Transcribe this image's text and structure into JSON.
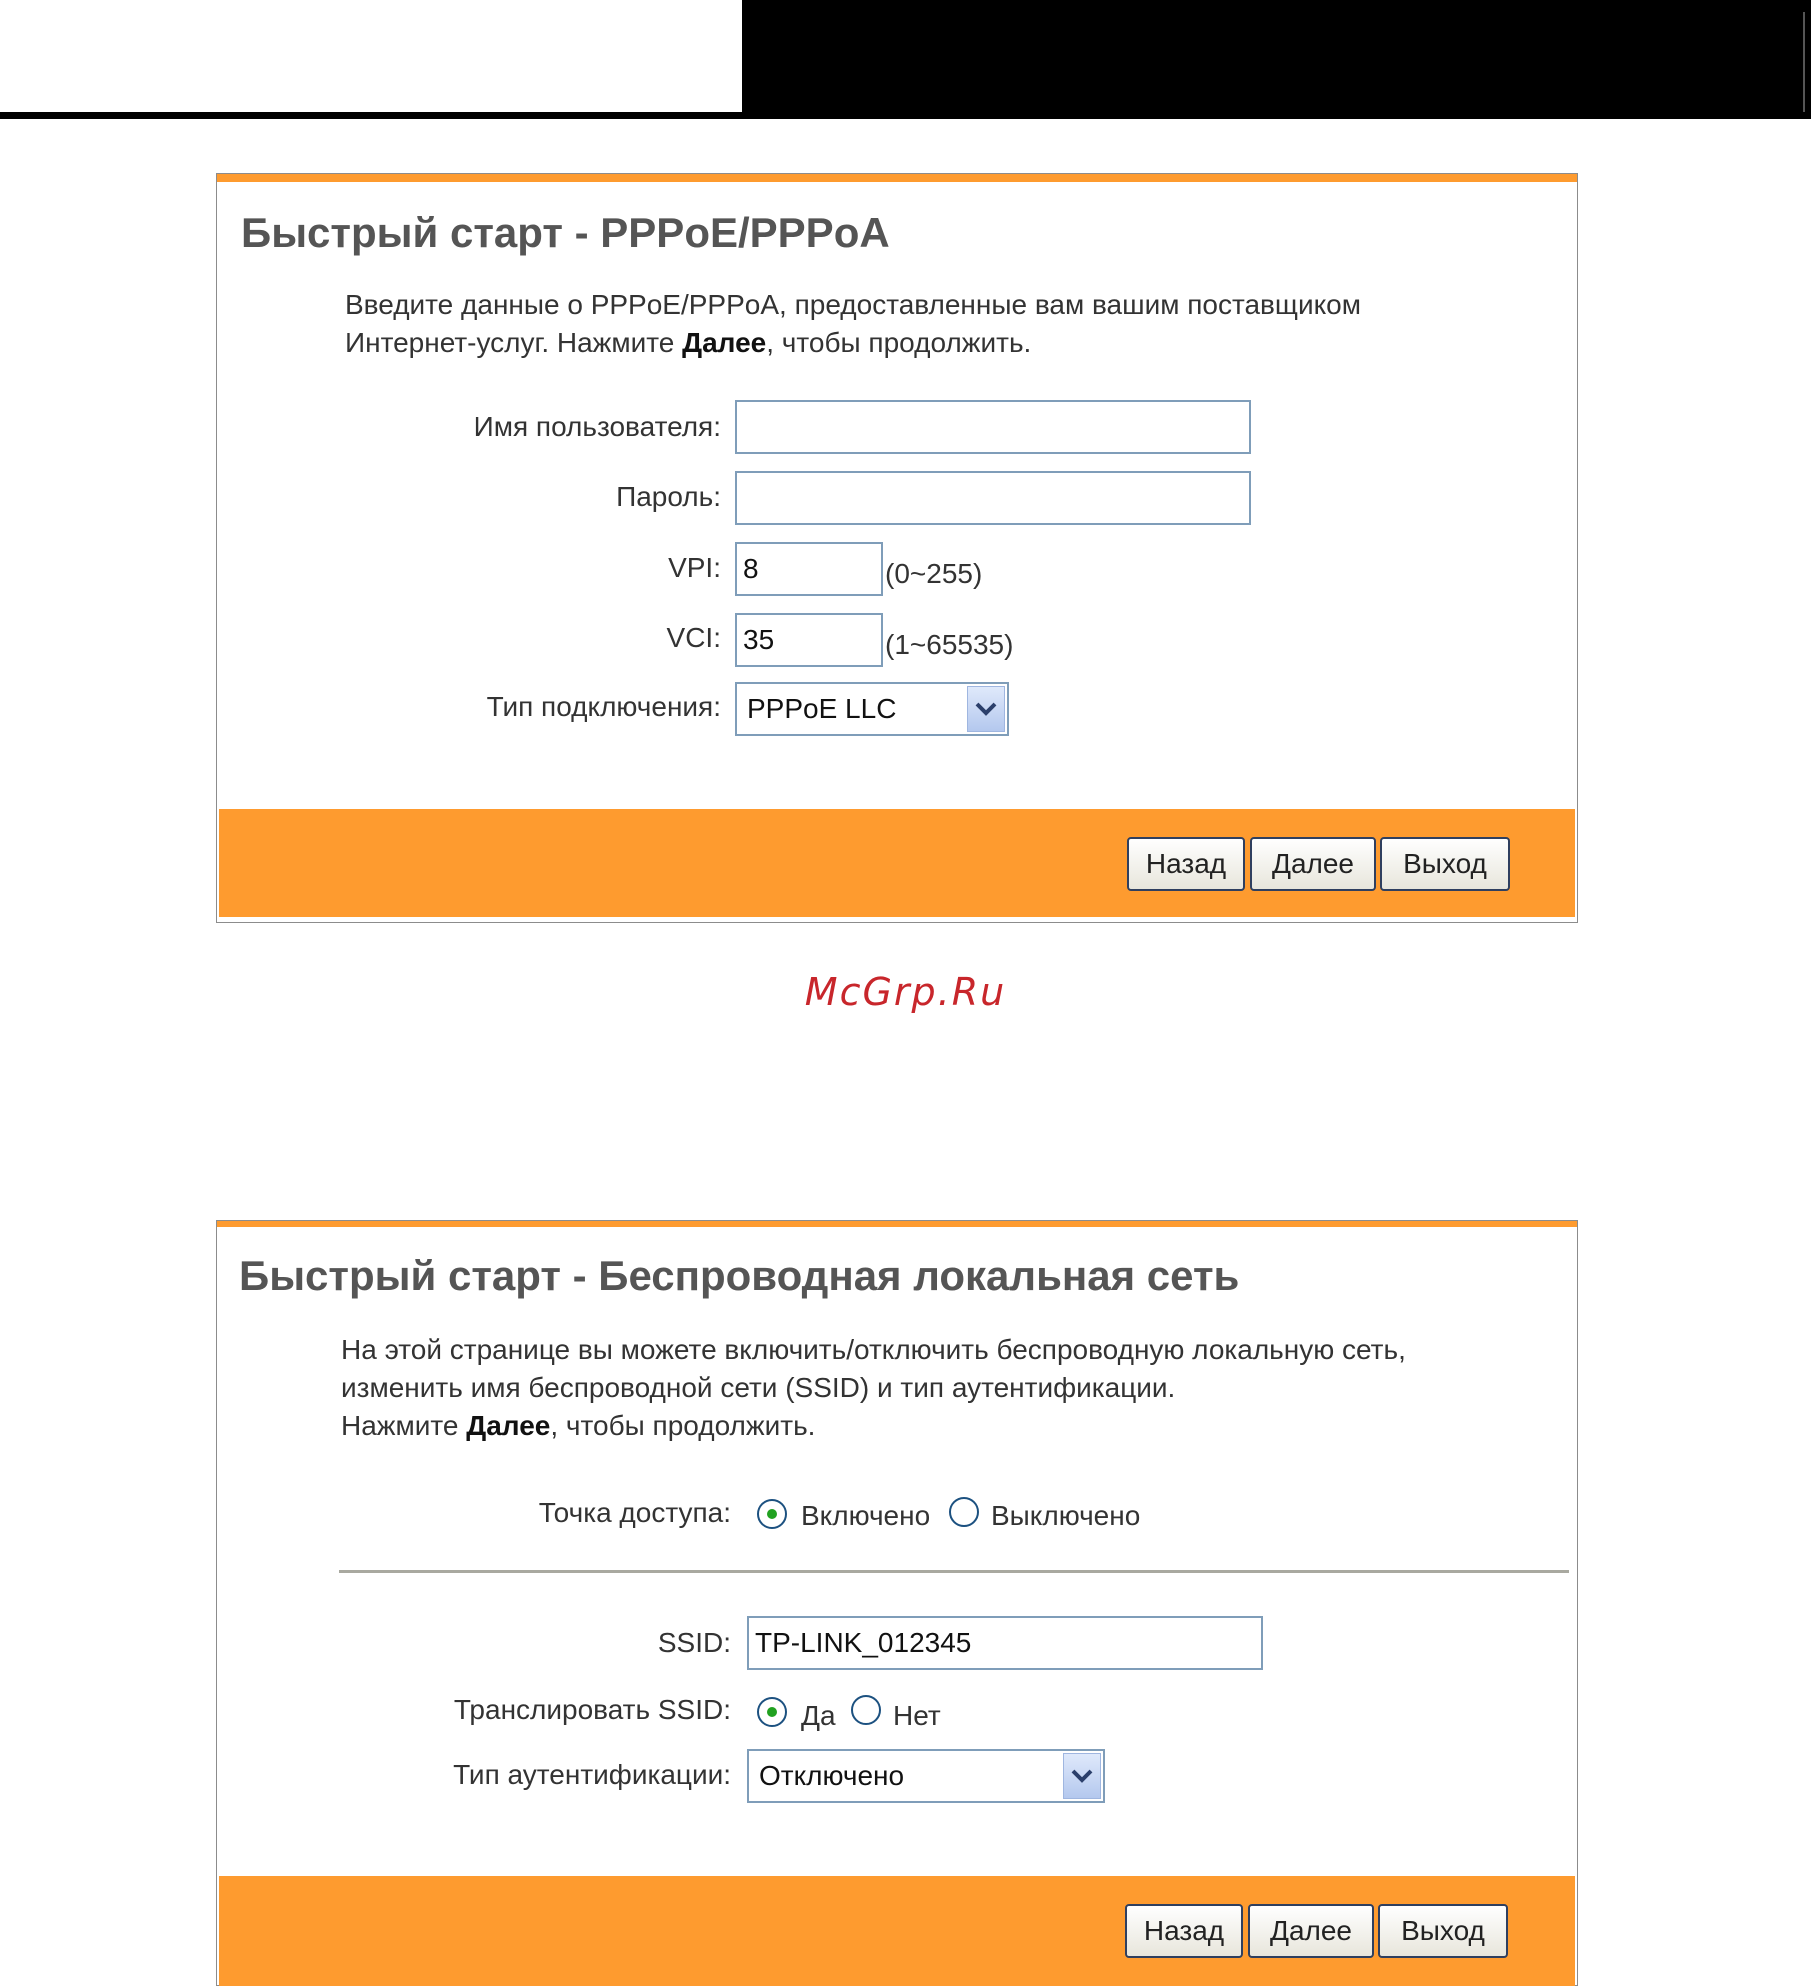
{
  "pppoe_panel": {
    "title": "Быстрый старт - PPPoE/PPPoA",
    "desc_line1": "Введите данные о PPPoE/PPPoA, предоставленные вам вашим поставщиком",
    "desc_line2_pre": "Интернет-услуг. Нажмите ",
    "desc_line2_bold": "Далее",
    "desc_line2_post": ", чтобы продолжить.",
    "username_label": "Имя пользователя:",
    "username_value": "",
    "password_label": "Пароль:",
    "password_value": "",
    "vpi_label": "VPI:",
    "vpi_value": "8",
    "vpi_hint": "(0~255)",
    "vci_label": "VCI:",
    "vci_value": "35",
    "vci_hint": "(1~65535)",
    "conn_type_label": "Тип подключения:",
    "conn_type_value": "PPPoE LLC",
    "back_label": "Назад",
    "next_label": "Далее",
    "exit_label": "Выход"
  },
  "watermark": "McGrp.Ru",
  "wlan_panel": {
    "title": "Быстрый старт - Беспроводная локальная сеть",
    "desc_line1": "На этой странице вы можете включить/отключить беспроводную локальную сеть,",
    "desc_line2": "изменить имя беспроводной сети (SSID) и тип аутентификации.",
    "desc_line3_pre": "Нажмите ",
    "desc_line3_bold": "Далее",
    "desc_line3_post": ", чтобы продолжить.",
    "ap_label": "Точка доступа:",
    "ap_on_label": "Включено",
    "ap_off_label": "Выключено",
    "ap_selected": "Включено",
    "ssid_label": "SSID:",
    "ssid_value": "TP-LINK_012345",
    "broadcast_label": "Транслировать SSID:",
    "broadcast_yes_label": "Да",
    "broadcast_no_label": "Нет",
    "broadcast_selected": "Да",
    "auth_type_label": "Тип аутентификации:",
    "auth_type_value": "Отключено",
    "back_label": "Назад",
    "next_label": "Далее",
    "exit_label": "Выход"
  },
  "colors": {
    "accent_orange": "#fe9b2f",
    "title_gray": "#555555",
    "watermark_red": "#c8262b",
    "radio_green": "#21a121"
  }
}
